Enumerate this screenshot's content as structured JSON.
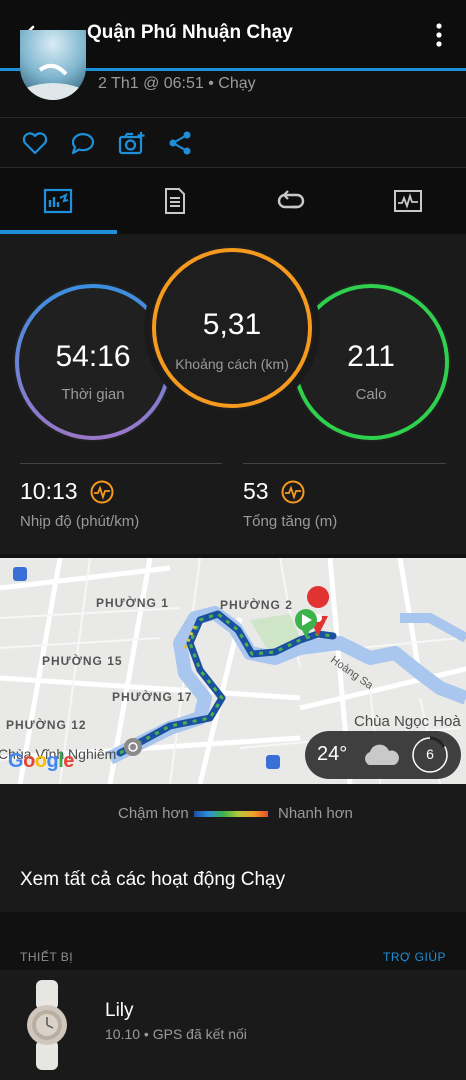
{
  "app_bar": {
    "title": "Quận Phú Nhuận Chạy"
  },
  "activity": {
    "meta": "2 Th1 @ 06:51 • Chạy"
  },
  "actions": [
    "heart-icon",
    "comment-icon",
    "camera-add-icon",
    "share-icon"
  ],
  "tabs": [
    "summary-chart-icon",
    "details-list-icon",
    "laps-icon",
    "stats-graph-icon"
  ],
  "circles": {
    "time": {
      "value": "54:16",
      "label": "Thời gian",
      "color": "#8a7fd6"
    },
    "distance": {
      "value": "5,31",
      "label": "Khoảng cách (km)",
      "color": "#f59a1f"
    },
    "calories": {
      "value": "211",
      "label": "Calo",
      "color": "#2fd04d"
    }
  },
  "metrics": {
    "pace": {
      "value": "10:13",
      "label": "Nhịp độ (phút/km)"
    },
    "elevation": {
      "value": "53",
      "label": "Tổng tăng (m)"
    }
  },
  "map": {
    "wards": [
      "PHƯỜNG 1",
      "PHƯỜNG 2",
      "PHƯỜNG 15",
      "PHƯỜNG 17",
      "PHƯỜNG 12"
    ],
    "street": "Hoàng Sa",
    "places": [
      "Chùa Ngọc Hoà",
      "Chùa Vĩnh Nghiêm"
    ],
    "google": "Google",
    "weather": {
      "temp": "24°",
      "uv": "6"
    }
  },
  "legend": {
    "slow": "Chậm hơn",
    "fast": "Nhanh hơn"
  },
  "view_all": "Xem tất cả các hoạt động Chạy",
  "devices_section": {
    "title": "THIẾT BỊ",
    "help": "TRỢ GIÚP"
  },
  "device": {
    "name": "Lily",
    "status": "10.10 • GPS đã kết nối"
  },
  "colors": {
    "accent": "#1e8fd9",
    "background": "#111111",
    "card": "#1a1a1a"
  }
}
